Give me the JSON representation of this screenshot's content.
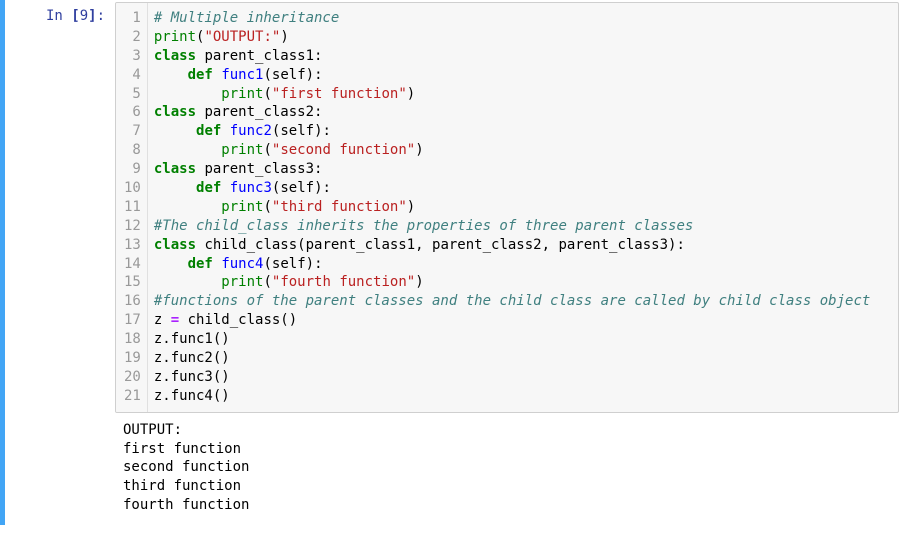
{
  "prompt": {
    "label": "In",
    "number": "9"
  },
  "code_lines": [
    [
      {
        "t": "comment",
        "v": "# Multiple inheritance"
      }
    ],
    [
      {
        "t": "builtin",
        "v": "print"
      },
      {
        "t": "paren",
        "v": "("
      },
      {
        "t": "string",
        "v": "\"OUTPUT:\""
      },
      {
        "t": "paren",
        "v": ")"
      }
    ],
    [
      {
        "t": "keyword",
        "v": "class"
      },
      {
        "t": "plain",
        "v": " parent_class1:"
      }
    ],
    [
      {
        "t": "plain",
        "v": "    "
      },
      {
        "t": "keyword",
        "v": "def"
      },
      {
        "t": "plain",
        "v": " "
      },
      {
        "t": "def",
        "v": "func1"
      },
      {
        "t": "paren",
        "v": "("
      },
      {
        "t": "name",
        "v": "self"
      },
      {
        "t": "paren",
        "v": ")"
      },
      {
        "t": "plain",
        "v": ":"
      }
    ],
    [
      {
        "t": "plain",
        "v": "        "
      },
      {
        "t": "builtin",
        "v": "print"
      },
      {
        "t": "paren",
        "v": "("
      },
      {
        "t": "string",
        "v": "\"first function\""
      },
      {
        "t": "paren",
        "v": ")"
      }
    ],
    [
      {
        "t": "keyword",
        "v": "class"
      },
      {
        "t": "plain",
        "v": " parent_class2:"
      }
    ],
    [
      {
        "t": "plain",
        "v": "     "
      },
      {
        "t": "keyword",
        "v": "def"
      },
      {
        "t": "plain",
        "v": " "
      },
      {
        "t": "def",
        "v": "func2"
      },
      {
        "t": "paren",
        "v": "("
      },
      {
        "t": "name",
        "v": "self"
      },
      {
        "t": "paren",
        "v": ")"
      },
      {
        "t": "plain",
        "v": ":"
      }
    ],
    [
      {
        "t": "plain",
        "v": "        "
      },
      {
        "t": "builtin",
        "v": "print"
      },
      {
        "t": "paren",
        "v": "("
      },
      {
        "t": "string",
        "v": "\"second function\""
      },
      {
        "t": "paren",
        "v": ")"
      }
    ],
    [
      {
        "t": "keyword",
        "v": "class"
      },
      {
        "t": "plain",
        "v": " parent_class3:"
      }
    ],
    [
      {
        "t": "plain",
        "v": "     "
      },
      {
        "t": "keyword",
        "v": "def"
      },
      {
        "t": "plain",
        "v": " "
      },
      {
        "t": "def",
        "v": "func3"
      },
      {
        "t": "paren",
        "v": "("
      },
      {
        "t": "name",
        "v": "self"
      },
      {
        "t": "paren",
        "v": ")"
      },
      {
        "t": "plain",
        "v": ":"
      }
    ],
    [
      {
        "t": "plain",
        "v": "        "
      },
      {
        "t": "builtin",
        "v": "print"
      },
      {
        "t": "paren",
        "v": "("
      },
      {
        "t": "string",
        "v": "\"third function\""
      },
      {
        "t": "paren",
        "v": ")"
      }
    ],
    [
      {
        "t": "comment",
        "v": "#The child_class inherits the properties of three parent classes"
      }
    ],
    [
      {
        "t": "keyword",
        "v": "class"
      },
      {
        "t": "plain",
        "v": " child_class(parent_class1, parent_class2, parent_class3):"
      }
    ],
    [
      {
        "t": "plain",
        "v": "    "
      },
      {
        "t": "keyword",
        "v": "def"
      },
      {
        "t": "plain",
        "v": " "
      },
      {
        "t": "def",
        "v": "func4"
      },
      {
        "t": "paren",
        "v": "("
      },
      {
        "t": "name",
        "v": "self"
      },
      {
        "t": "paren",
        "v": ")"
      },
      {
        "t": "plain",
        "v": ":"
      }
    ],
    [
      {
        "t": "plain",
        "v": "        "
      },
      {
        "t": "builtin",
        "v": "print"
      },
      {
        "t": "paren",
        "v": "("
      },
      {
        "t": "string",
        "v": "\"fourth function\""
      },
      {
        "t": "paren",
        "v": ")"
      }
    ],
    [
      {
        "t": "comment",
        "v": "#functions of the parent classes and the child class are called by child class object"
      }
    ],
    [
      {
        "t": "plain",
        "v": "z "
      },
      {
        "t": "op",
        "v": "="
      },
      {
        "t": "plain",
        "v": " child_class()"
      }
    ],
    [
      {
        "t": "plain",
        "v": "z.func1()"
      }
    ],
    [
      {
        "t": "plain",
        "v": "z.func2()"
      }
    ],
    [
      {
        "t": "plain",
        "v": "z.func3()"
      }
    ],
    [
      {
        "t": "plain",
        "v": "z.func4()"
      }
    ]
  ],
  "output_lines": [
    "OUTPUT:",
    "first function",
    "second function",
    "third function",
    "fourth function"
  ]
}
